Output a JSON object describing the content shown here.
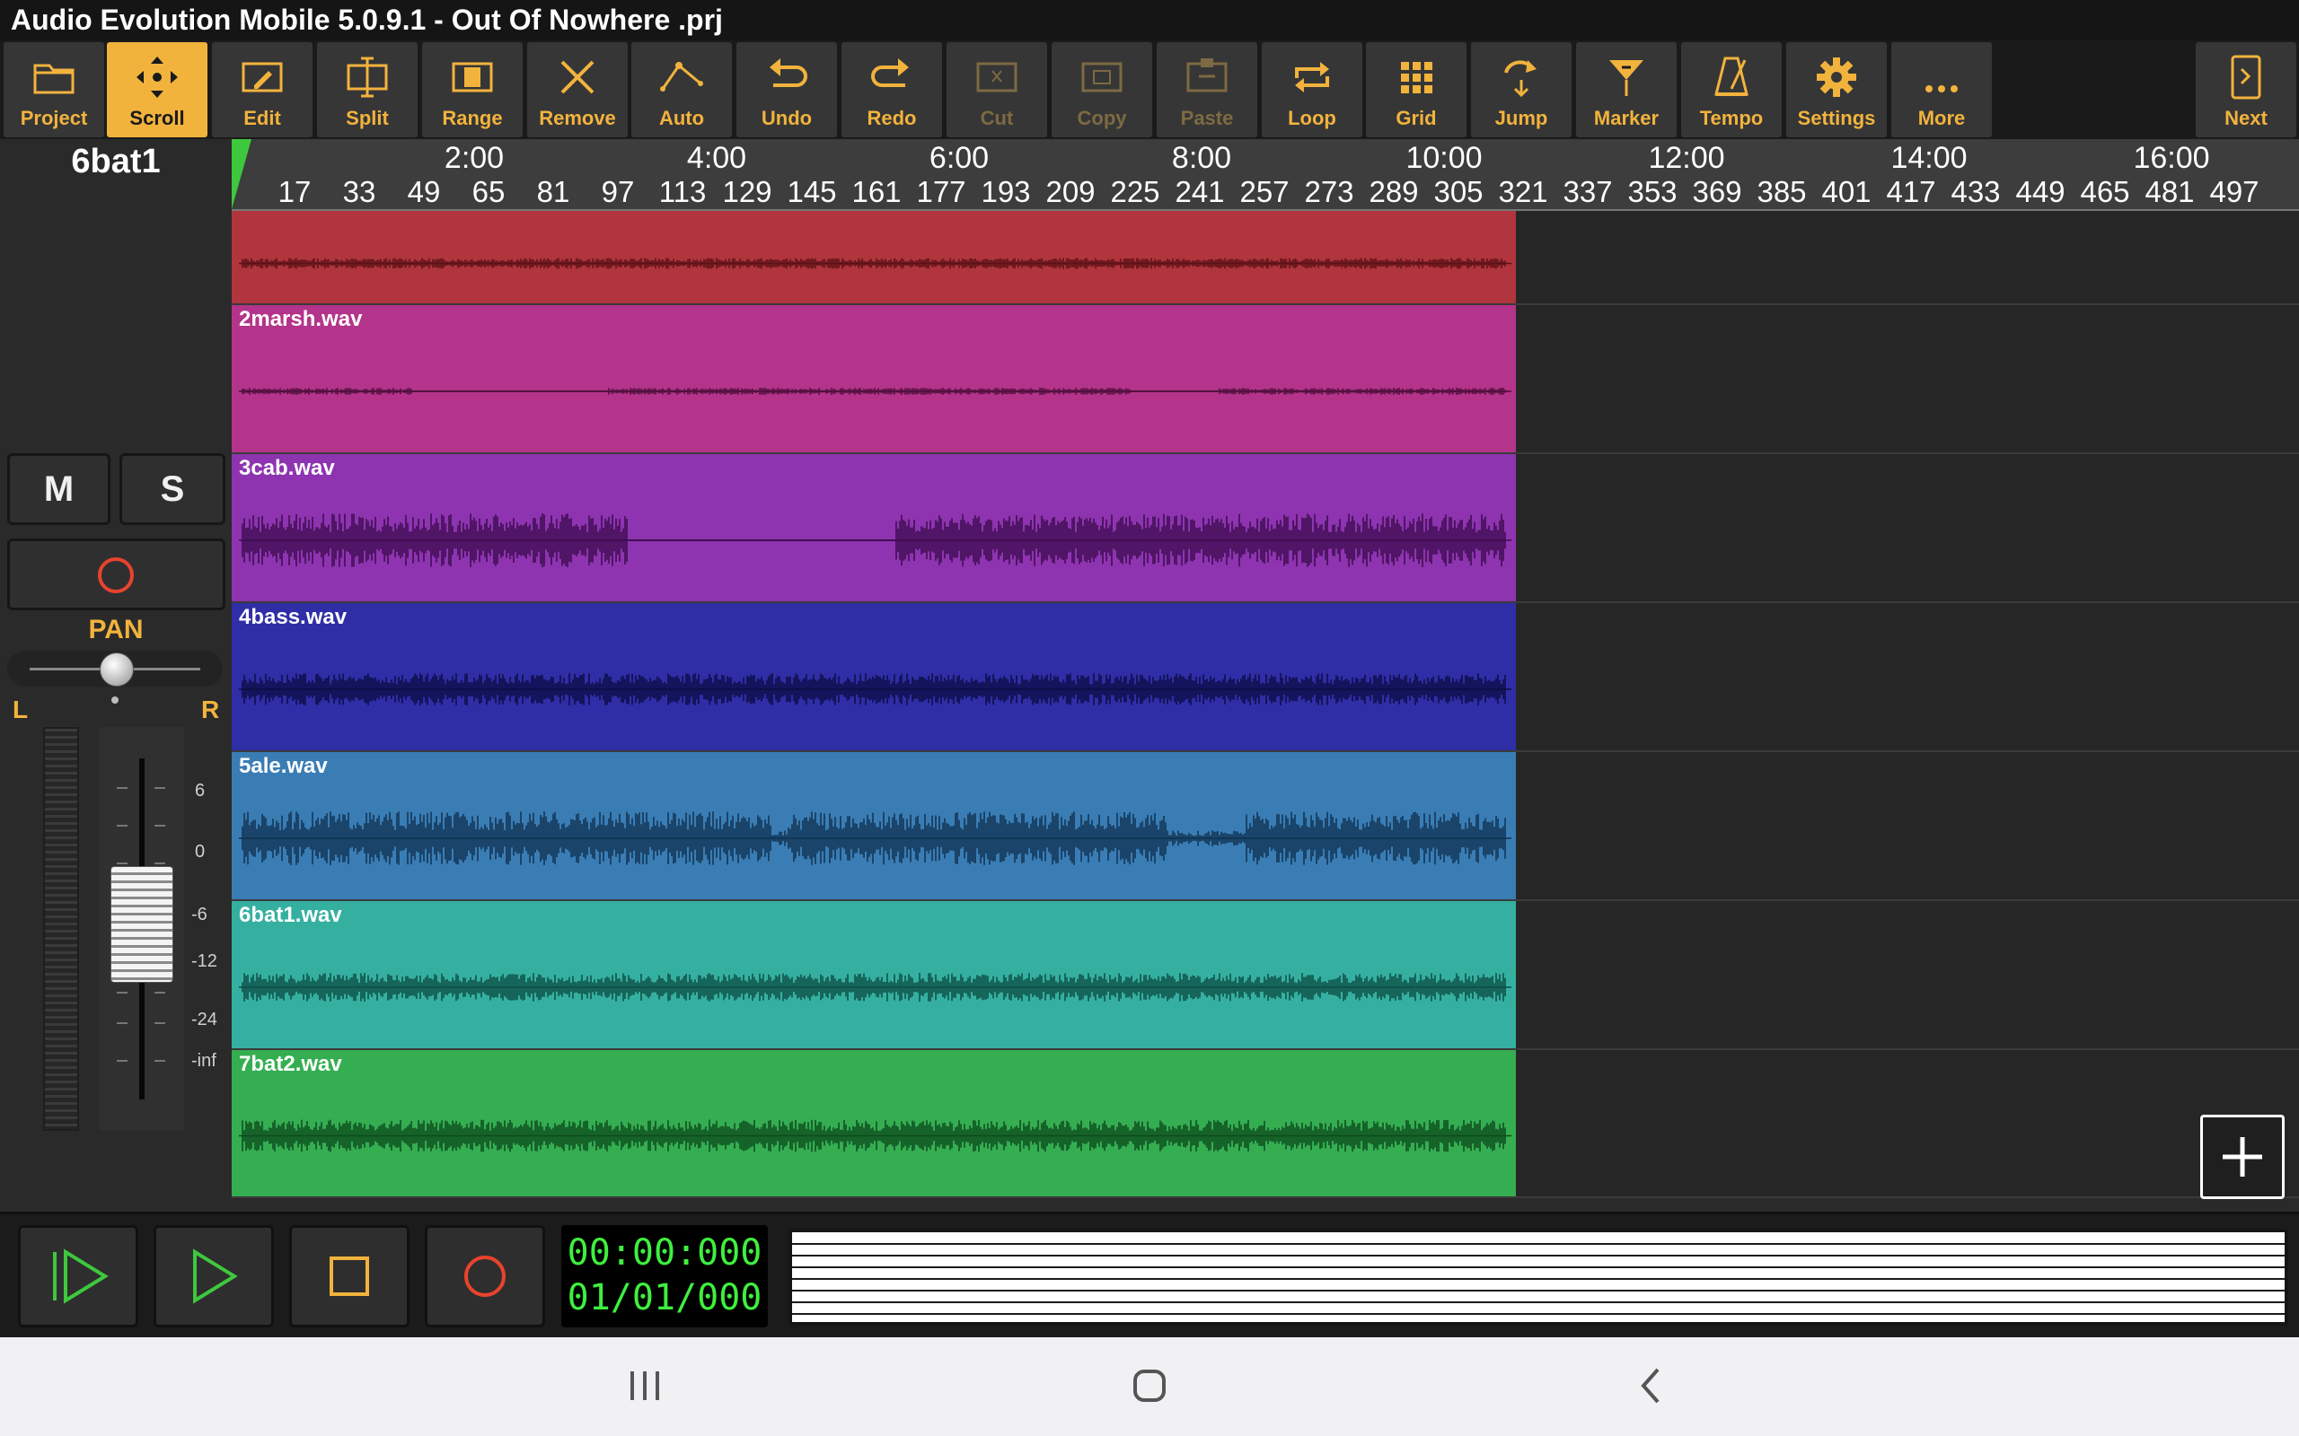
{
  "window": {
    "title": "Audio Evolution Mobile 5.0.9.1 - Out Of Nowhere .prj"
  },
  "toolbar": {
    "items": [
      {
        "label": "Project",
        "icon": "folder-icon",
        "state": "normal"
      },
      {
        "label": "Scroll",
        "icon": "scroll-icon",
        "state": "active"
      },
      {
        "label": "Edit",
        "icon": "edit-icon",
        "state": "normal"
      },
      {
        "label": "Split",
        "icon": "split-icon",
        "state": "normal"
      },
      {
        "label": "Range",
        "icon": "range-icon",
        "state": "normal"
      },
      {
        "label": "Remove",
        "icon": "close-icon",
        "state": "normal"
      },
      {
        "label": "Auto",
        "icon": "automation-icon",
        "state": "normal"
      },
      {
        "label": "Undo",
        "icon": "undo-icon",
        "state": "normal"
      },
      {
        "label": "Redo",
        "icon": "redo-icon",
        "state": "normal"
      },
      {
        "label": "Cut",
        "icon": "cut-icon",
        "state": "disabled"
      },
      {
        "label": "Copy",
        "icon": "copy-icon",
        "state": "disabled"
      },
      {
        "label": "Paste",
        "icon": "paste-icon",
        "state": "disabled"
      },
      {
        "label": "Loop",
        "icon": "loop-icon",
        "state": "normal"
      },
      {
        "label": "Grid",
        "icon": "grid-icon",
        "state": "normal"
      },
      {
        "label": "Jump",
        "icon": "jump-icon",
        "state": "normal"
      },
      {
        "label": "Marker",
        "icon": "marker-icon",
        "state": "normal"
      },
      {
        "label": "Tempo",
        "icon": "metronome-icon",
        "state": "normal"
      },
      {
        "label": "Settings",
        "icon": "gear-icon",
        "state": "normal"
      },
      {
        "label": "More",
        "icon": "more-icon",
        "state": "normal"
      }
    ],
    "next": {
      "label": "Next",
      "icon": "next-page-icon"
    }
  },
  "track_panel": {
    "selected_track": "6bat1",
    "mute_label": "M",
    "solo_label": "S",
    "record_arm_icon": "record-icon",
    "pan": {
      "label": "PAN",
      "left": "L",
      "right": "R",
      "value": 0
    },
    "fader_scale": [
      "6",
      "0",
      "-6",
      "-12",
      "-24",
      "-inf"
    ]
  },
  "timeline": {
    "times": [
      "2:00",
      "4:00",
      "6:00",
      "8:00",
      "10:00",
      "12:00",
      "14:00",
      "16:00"
    ],
    "bars": [
      "17",
      "33",
      "49",
      "65",
      "81",
      "97",
      "113",
      "129",
      "145",
      "161",
      "177",
      "193",
      "209",
      "225",
      "241",
      "257",
      "273",
      "289",
      "305",
      "321",
      "337",
      "353",
      "369",
      "385",
      "401",
      "417",
      "433",
      "449",
      "465",
      "481",
      "497"
    ]
  },
  "tracks": [
    {
      "name": "",
      "color": "#b0353c",
      "wave": "#5a1116"
    },
    {
      "name": "2marsh.wav",
      "color": "#b3348a",
      "wave": "#4e0e3b"
    },
    {
      "name": "3cab.wav",
      "color": "#8e34b0",
      "wave": "#3b0b4e"
    },
    {
      "name": "4bass.wav",
      "color": "#2f2ea6",
      "wave": "#0c0c45"
    },
    {
      "name": "5ale.wav",
      "color": "#3a7db5",
      "wave": "#0f3150"
    },
    {
      "name": "6bat1.wav",
      "color": "#35b0a0",
      "wave": "#0d4c44"
    },
    {
      "name": "7bat2.wav",
      "color": "#35ae52",
      "wave": "#0d4a1c"
    }
  ],
  "transport": {
    "counter_time": "00:00:000",
    "counter_bars": "01/01/000"
  },
  "colors": {
    "accent": "#f2b33d",
    "counter": "#3ef03e",
    "record": "#e8432e"
  }
}
